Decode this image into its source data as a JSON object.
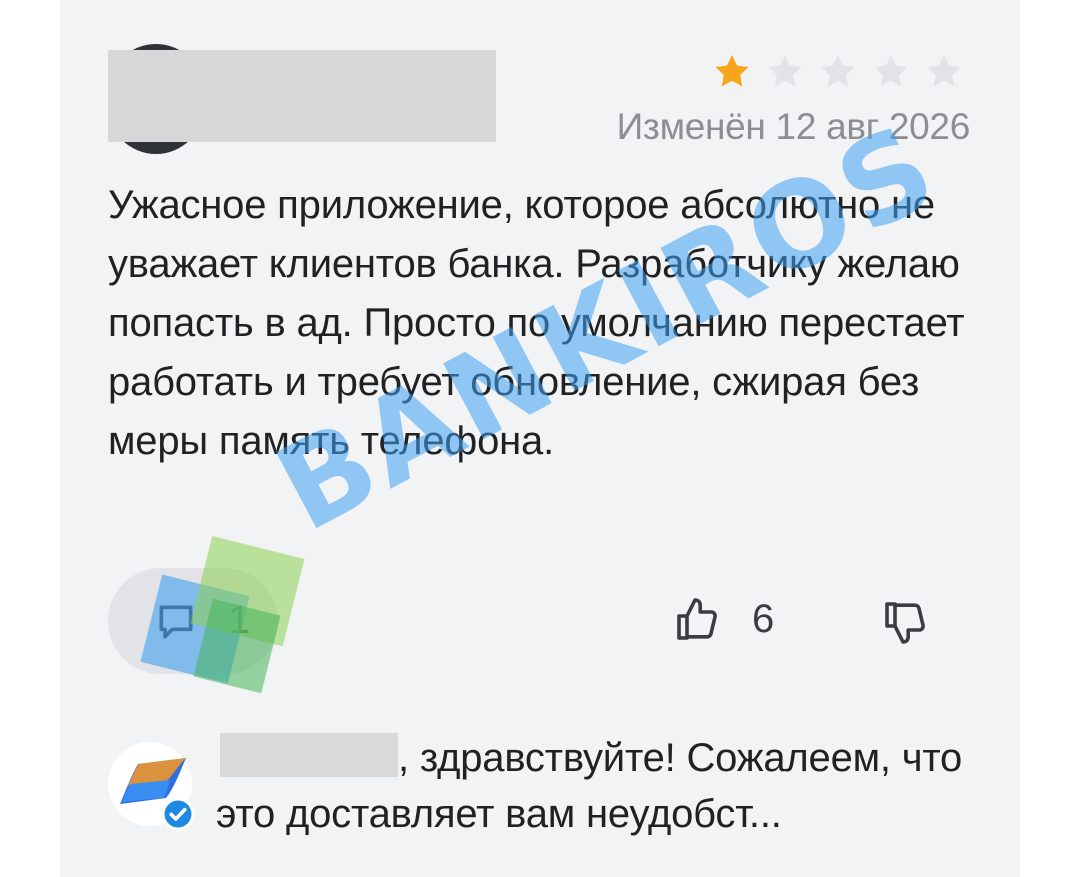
{
  "review": {
    "rating": 1,
    "rating_max": 5,
    "edited_label": "Изменён 12 авг 2026",
    "text": "Ужасное приложение, которое абсолютно не уважает клиентов банка. Разработчику желаю попасть в ад. Просто по умолчанию перестает работать и требует обновление, сжирая без меры память телефона.",
    "reply_count": "1",
    "likes": "6"
  },
  "bank_reply": {
    "text": ", здравствуйте! Сожалеем, что это доставляет вам неудобст..."
  },
  "watermark": {
    "text": "BANKIROS"
  },
  "colors": {
    "star_active": "#f7a51a",
    "star_inactive": "#e1e3e6",
    "watermark": "#40a0f0",
    "verified": "#1e88e5"
  }
}
